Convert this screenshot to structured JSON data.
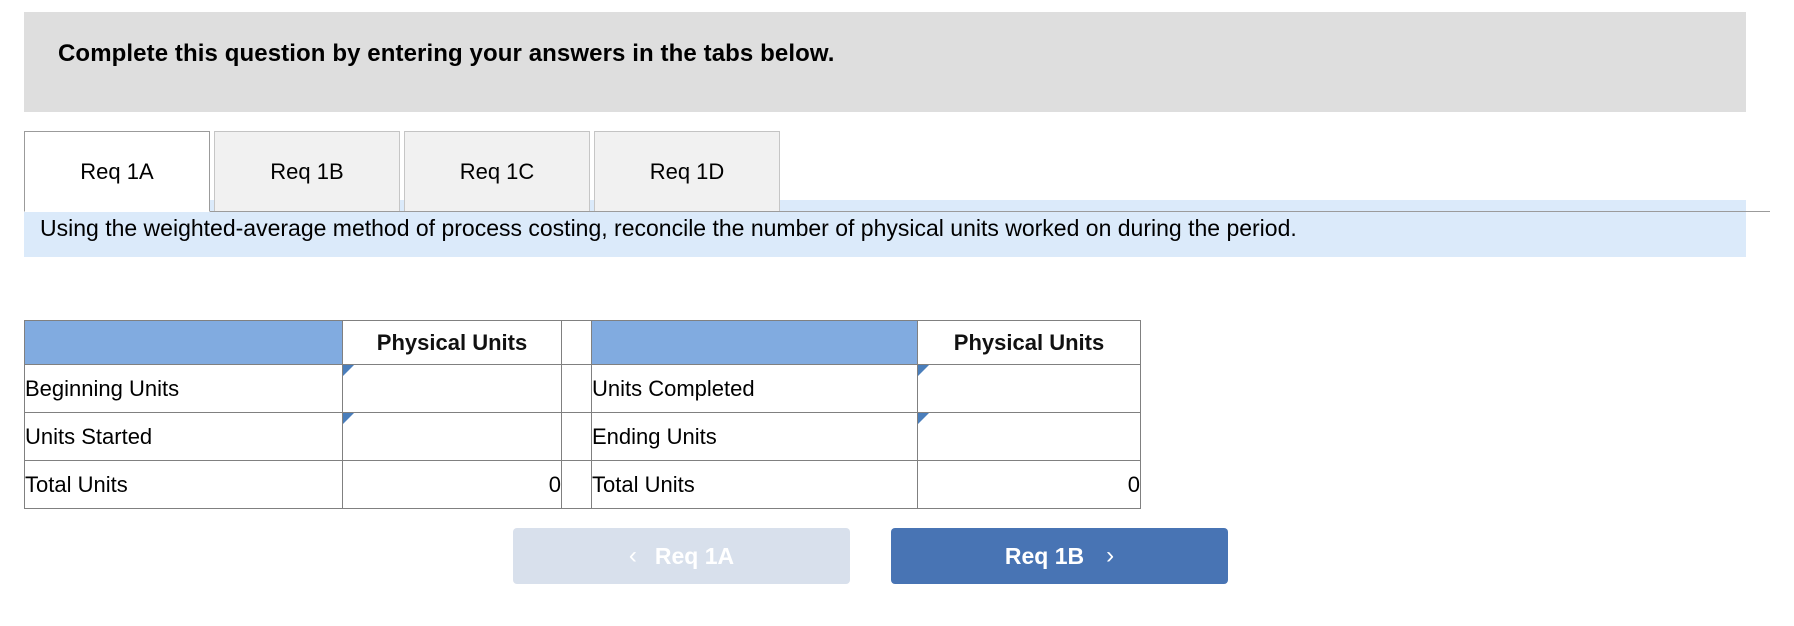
{
  "banner": {
    "text": "Complete this question by entering your answers in the tabs below."
  },
  "tabs": [
    {
      "label": "Req 1A",
      "active": true
    },
    {
      "label": "Req 1B",
      "active": false
    },
    {
      "label": "Req 1C",
      "active": false
    },
    {
      "label": "Req 1D",
      "active": false
    }
  ],
  "instruction": {
    "text": "Using the weighted-average method of process costing, reconcile the number of physical units worked on during the period."
  },
  "table": {
    "left": {
      "header_label": "",
      "header_value": "Physical Units",
      "rows": [
        {
          "label": "Beginning Units",
          "value": "",
          "type": "input"
        },
        {
          "label": "Units Started",
          "value": "",
          "type": "input"
        },
        {
          "label": "Total Units",
          "value": "0",
          "type": "total"
        }
      ]
    },
    "right": {
      "header_label": "",
      "header_value": "Physical Units",
      "rows": [
        {
          "label": "Units Completed",
          "value": "",
          "type": "input"
        },
        {
          "label": "Ending Units",
          "value": "",
          "type": "input"
        },
        {
          "label": "Total Units",
          "value": "0",
          "type": "total"
        }
      ]
    }
  },
  "nav": {
    "prev_label": "Req 1A",
    "prev_icon": "chevron-left-icon",
    "prev_glyph": "‹",
    "next_label": "Req 1B",
    "next_icon": "chevron-right-icon",
    "next_glyph": "›"
  },
  "colors": {
    "banner_bg": "#dedede",
    "instruction_bg": "#dbeafa",
    "table_header_bg": "#81abe0",
    "input_border": "#4a7ebb",
    "primary_button": "#4874b4",
    "disabled_button": "#d8e0ec"
  }
}
